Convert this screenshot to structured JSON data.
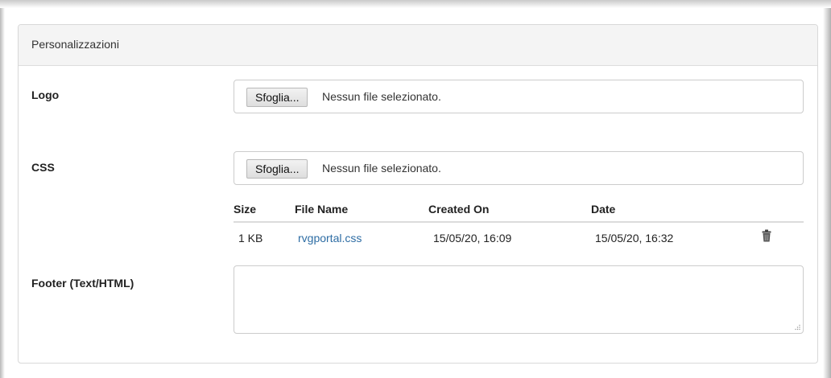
{
  "panel": {
    "title": "Personalizzazioni"
  },
  "logo": {
    "label": "Logo",
    "browse_label": "Sfoglia...",
    "status": "Nessun file selezionato."
  },
  "css": {
    "label": "CSS",
    "browse_label": "Sfoglia...",
    "status": "Nessun file selezionato.",
    "table": {
      "columns": [
        "Size",
        "File Name",
        "Created On",
        "Date"
      ],
      "rows": [
        {
          "size": "1 KB",
          "file_name": "rvgportal.css",
          "created_on": "15/05/20, 16:09",
          "date": "15/05/20, 16:32",
          "action_icon": "trash-icon"
        }
      ]
    }
  },
  "footer": {
    "label": "Footer (Text/HTML)",
    "value": ""
  },
  "colors": {
    "link": "#2e6da4",
    "panel_heading_bg": "#f4f4f4",
    "border": "#cccccc"
  }
}
